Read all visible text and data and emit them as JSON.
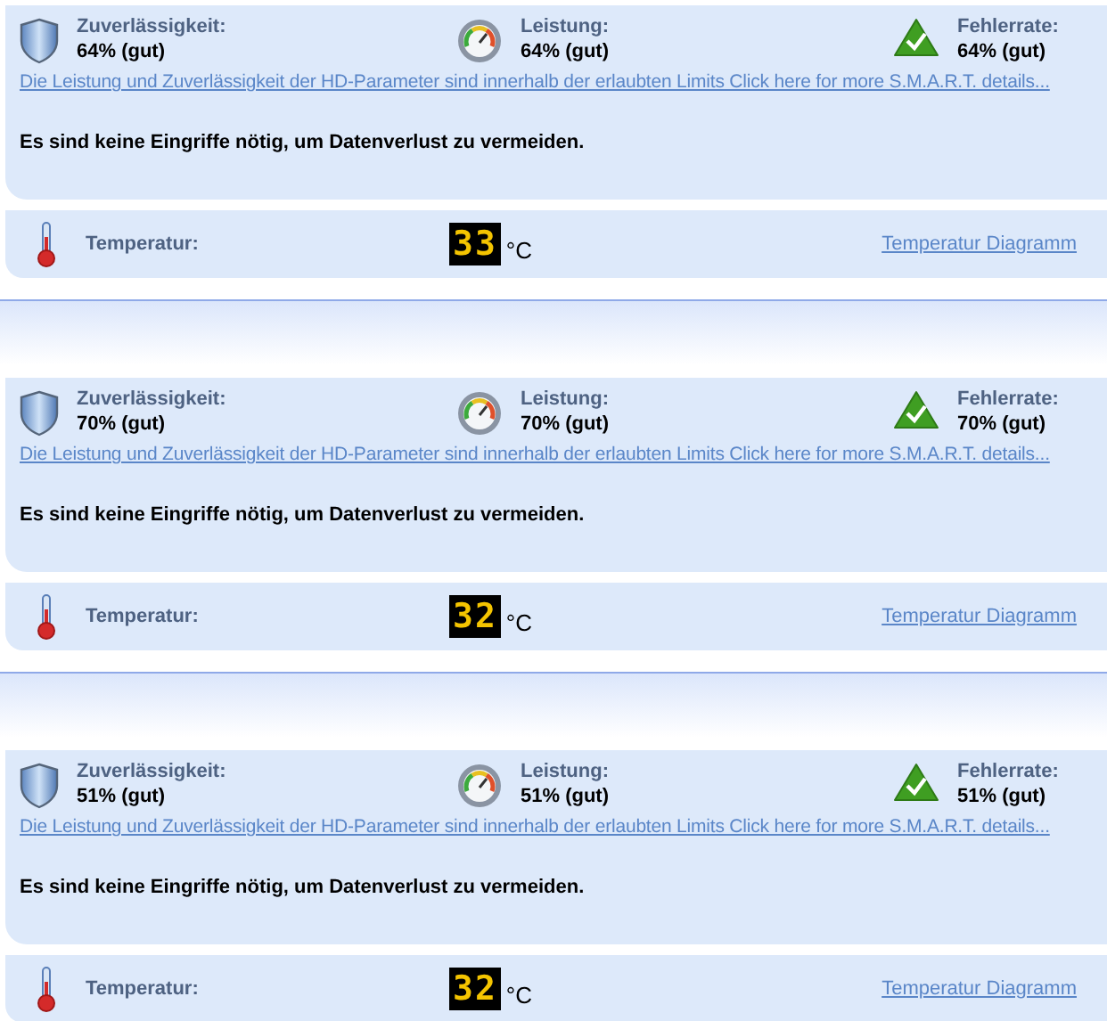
{
  "drives": [
    {
      "metrics": [
        {
          "kind": "shield",
          "label": "Zuverlässigkeit:",
          "value": "64% (gut)"
        },
        {
          "kind": "gauge",
          "label": "Leistung:",
          "value": "64% (gut)"
        },
        {
          "kind": "check",
          "label": "Fehlerrate:",
          "value": "64% (gut)"
        }
      ],
      "details_link": "Die Leistung und Zuverlässigkeit der HD-Parameter sind innerhalb der erlaubten Limits Click here for more S.M.A.R.T. details...",
      "message": "Es sind keine Eingriffe nötig, um Datenverlust zu vermeiden.",
      "temperature": {
        "label": "Temperatur:",
        "value": "33",
        "unit": "°C",
        "diagram_link": "Temperatur Diagramm"
      }
    },
    {
      "metrics": [
        {
          "kind": "shield",
          "label": "Zuverlässigkeit:",
          "value": "70% (gut)"
        },
        {
          "kind": "gauge",
          "label": "Leistung:",
          "value": "70% (gut)"
        },
        {
          "kind": "check",
          "label": "Fehlerrate:",
          "value": "70% (gut)"
        }
      ],
      "details_link": "Die Leistung und Zuverlässigkeit der HD-Parameter sind innerhalb der erlaubten Limits Click here for more S.M.A.R.T. details...",
      "message": "Es sind keine Eingriffe nötig, um Datenverlust zu vermeiden.",
      "temperature": {
        "label": "Temperatur:",
        "value": "32",
        "unit": "°C",
        "diagram_link": "Temperatur Diagramm"
      }
    },
    {
      "metrics": [
        {
          "kind": "shield",
          "label": "Zuverlässigkeit:",
          "value": "51% (gut)"
        },
        {
          "kind": "gauge",
          "label": "Leistung:",
          "value": "51% (gut)"
        },
        {
          "kind": "check",
          "label": "Fehlerrate:",
          "value": "51% (gut)"
        }
      ],
      "details_link": "Die Leistung und Zuverlässigkeit der HD-Parameter sind innerhalb der erlaubten Limits Click here for more S.M.A.R.T. details...",
      "message": "Es sind keine Eingriffe nötig, um Datenverlust zu vermeiden.",
      "temperature": {
        "label": "Temperatur:",
        "value": "32",
        "unit": "°C",
        "diagram_link": "Temperatur Diagramm"
      }
    }
  ]
}
